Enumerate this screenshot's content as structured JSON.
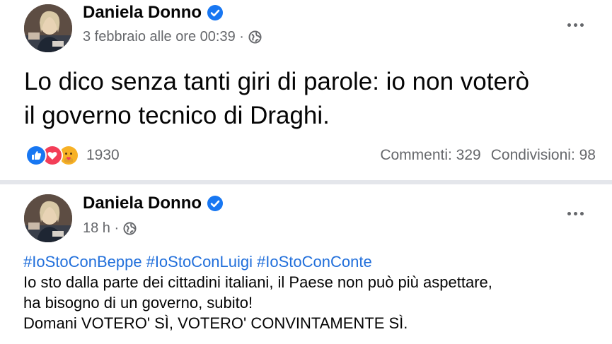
{
  "posts": [
    {
      "author": "Daniela Donno",
      "timestamp": "3 febbraio alle ore 00:39 ·",
      "text_lines": [
        "Lo dico senza tanti giri di parole: io non voterò",
        "il governo tecnico di Draghi."
      ],
      "reactions": {
        "count": "1930",
        "icons": [
          "like-icon",
          "love-icon",
          "care-icon"
        ]
      },
      "comments": "Commenti: 329",
      "shares": "Condivisioni: 98"
    },
    {
      "author": "Daniela Donno",
      "timestamp": "18 h ·",
      "hashtags": [
        "#IoStoConBeppe",
        "#IoStoConLuigi",
        "#IoStoConConte"
      ],
      "text_lines": [
        "Io sto dalla parte dei cittadini italiani, il Paese non può più aspettare,",
        "ha bisogno di un governo, subito!",
        "Domani VOTERO' SÌ, VOTERO' CONVINTAMENTE SÌ."
      ]
    }
  ],
  "colors": {
    "link": "#216fdb",
    "secondary_text": "#65676b",
    "verified": "#1877f2",
    "like": "#1877f2",
    "love": "#f33e58",
    "care": "#f7b125"
  }
}
